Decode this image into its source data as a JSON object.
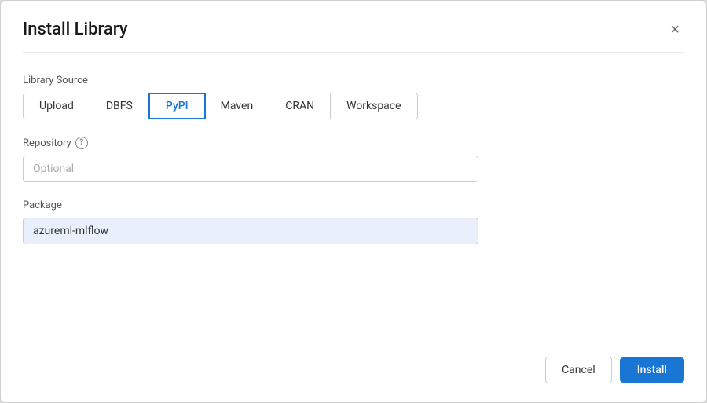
{
  "dialog": {
    "title": "Install Library",
    "close_label": "×"
  },
  "library_source": {
    "label": "Library Source",
    "tabs": [
      {
        "id": "upload",
        "label": "Upload",
        "active": false
      },
      {
        "id": "dbfs",
        "label": "DBFS",
        "active": false
      },
      {
        "id": "pypi",
        "label": "PyPI",
        "active": true
      },
      {
        "id": "maven",
        "label": "Maven",
        "active": false
      },
      {
        "id": "cran",
        "label": "CRAN",
        "active": false
      },
      {
        "id": "workspace",
        "label": "Workspace",
        "active": false
      }
    ]
  },
  "repository": {
    "label": "Repository",
    "placeholder": "Optional",
    "value": "",
    "has_help": true
  },
  "package": {
    "label": "Package",
    "placeholder": "",
    "value": "azureml-mlflow"
  },
  "footer": {
    "cancel_label": "Cancel",
    "install_label": "Install"
  }
}
